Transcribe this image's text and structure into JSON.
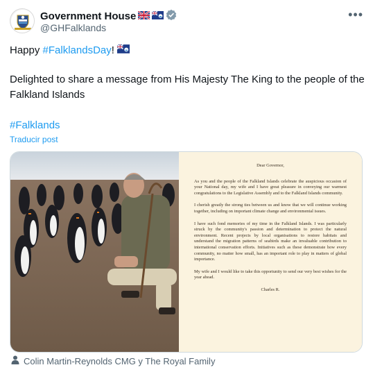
{
  "header": {
    "name": "Government House",
    "handle": "@GHFalklands",
    "more_label": "•••"
  },
  "tweet": {
    "line1_prefix": "Happy ",
    "line1_hashtag": "#FalklandsDay",
    "line1_suffix": "!",
    "line2": "Delighted to share a message from His Majesty The King to the people of the Falkland Islands",
    "line3_hashtag": "#Falklands",
    "translate_label": "Traducir post"
  },
  "letter": {
    "greeting": "Dear Governor,",
    "p1": "As you and the people of the Falkland Islands celebrate the auspicious occasion of your National day, my wife and I have great pleasure in conveying our warmest congratulations to the Legislative Assembly and to the Falkland Islands community.",
    "p2": "I cherish greatly the strong ties between us and know that we will continue working together, including on important climate change and environmental issues.",
    "p3": "I have such fond memories of my time in the Falkland Islands. I was particularly struck by the community's passion and determination to protect the natural environment. Recent projects by local organisations to restore habitats and understand the migration patterns of seabirds make an invaluable contribution to international conservation efforts. Initiatives such as these demonstrate how every community, no matter how small, has an important role to play in matters of global importance.",
    "p4": "My wife and I would like to take this opportunity to send our very best wishes for the year ahead.",
    "signature": "Charles R."
  },
  "credit": {
    "text": "Colin Martin-Reynolds CMG y The Royal Family",
    "icon": "person-icon"
  },
  "colors": {
    "accent": "#1d9bf0",
    "verified": "#829aab",
    "letter_bg": "#fbf3df"
  }
}
